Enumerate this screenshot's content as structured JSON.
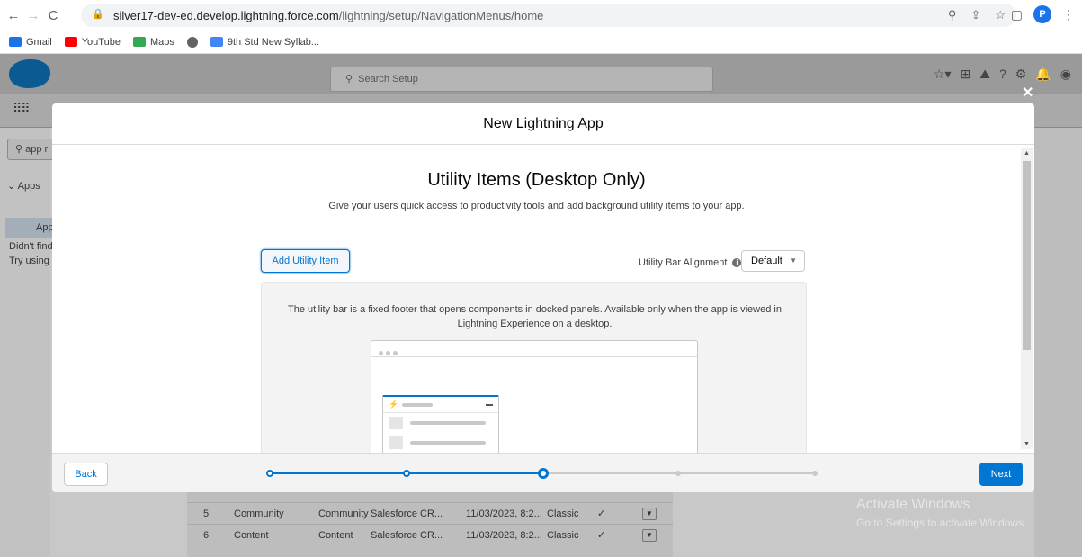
{
  "browser": {
    "url_host": "silver17-dev-ed.develop.lightning.force.com",
    "url_path": "/lightning/setup/NavigationMenus/home",
    "profile_initial": "P",
    "bookmarks": [
      {
        "label": "Gmail",
        "color": "#1a73e8"
      },
      {
        "label": "YouTube",
        "color": "#ff0000"
      },
      {
        "label": "Maps",
        "color": "#34a853"
      },
      {
        "label": "",
        "color": "#5f6368"
      },
      {
        "label": "9th Std New Syllab...",
        "color": "#4285f4"
      }
    ]
  },
  "setup": {
    "search_placeholder": "Search Setup",
    "quick_find_value": "app r",
    "left_apps": "Apps",
    "left_app_item": "App",
    "left_didnt": "Didn't find",
    "left_try": "Try using C",
    "table_rows": [
      {
        "num": "5",
        "name": "Community",
        "dev": "Community",
        "desc": "Salesforce CR...",
        "date": "11/03/2023, 8:2...",
        "type": "Classic",
        "check": "✓"
      },
      {
        "num": "6",
        "name": "Content",
        "dev": "Content",
        "desc": "Salesforce CR...",
        "date": "11/03/2023, 8:2...",
        "type": "Classic",
        "check": "✓"
      }
    ],
    "activate_title": "Activate Windows",
    "activate_sub": "Go to Settings to activate Windows."
  },
  "modal": {
    "title": "New Lightning App",
    "step_title": "Utility Items (Desktop Only)",
    "step_desc": "Give your users quick access to productivity tools and add background utility items to your app.",
    "add_button": "Add Utility Item",
    "alignment_label": "Utility Bar Alignment",
    "alignment_value": "Default",
    "info_text": "The utility bar is a fixed footer that opens components in docked panels. Available only when the app is viewed in Lightning Experience on a desktop.",
    "back_label": "Back",
    "next_label": "Next",
    "progress": {
      "total_steps": 5,
      "current_step": 3
    }
  },
  "colors": {
    "brand": "#0176d3",
    "overlay_bg": "#c8c8c8"
  }
}
